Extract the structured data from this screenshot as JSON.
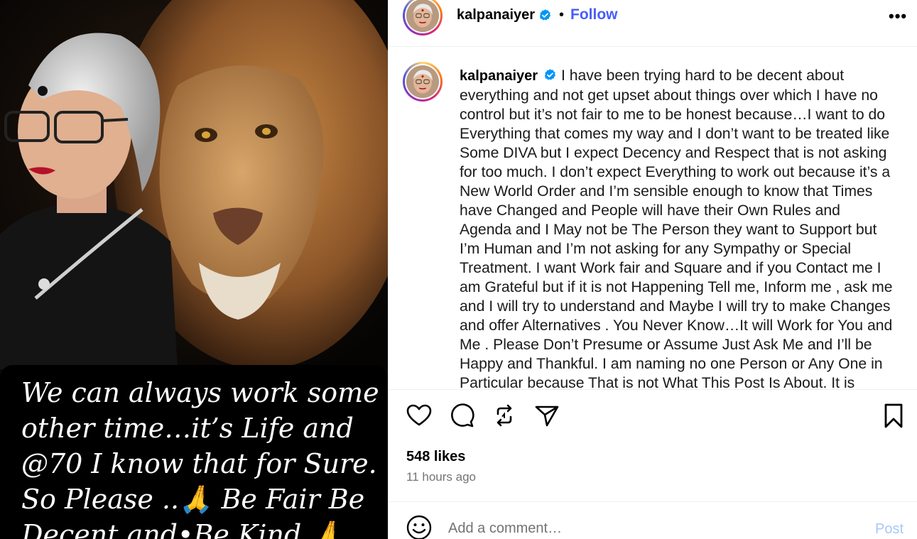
{
  "media": {
    "overlay_lines": [
      "We can always work some",
      "other time…it’s Life and",
      "@70 I know that for Sure.",
      "So Please ..🙏 Be Fair Be",
      "Decent and•Be Kind 🙏"
    ]
  },
  "header": {
    "username": "kalpanaiyer",
    "separator": "•",
    "follow_label": "Follow",
    "more_label": "•••"
  },
  "caption": {
    "username": "kalpanaiyer",
    "text": "I have been trying hard to be decent about everything and not get upset about things over which I have no control but it’s not fair to me to be honest because…I want to do Everything that comes my way and I don’t want to be treated like Some DIVA but I expect Decency and Respect that is not asking for too much. I don’t expect Everything to work out because it’s a New World Order and I’m sensible enough to know that Times have Changed and People will have their Own Rules and Agenda and I May not be The Person they want to Support but I’m Human and I’m not asking for any Sympathy or Special Treatment. I want Work fair and Square and if you Contact me I am Grateful but if it is not Happening Tell me, Inform me , ask me and I will try to understand and Maybe I will try to make Changes and offer Alternatives . You Never Know…It will Work for You and Me . Please Don’t Presume or Assume Just Ask Me and I’ll be Happy and Thankful. I am naming no one Person or Any One in Particular because That is not What This Post Is About. It is about"
  },
  "stats": {
    "likes": "548 likes",
    "time_ago": "11 hours ago"
  },
  "comment": {
    "placeholder": "Add a comment…",
    "post_label": "Post"
  },
  "colors": {
    "follow": "#4a5cf7",
    "verified": "#0095f6",
    "post_disabled": "#a6c8f7"
  },
  "icons": [
    "heart-icon",
    "comment-icon",
    "repost-icon",
    "share-icon",
    "bookmark-icon",
    "emoji-icon",
    "verified-badge-icon"
  ]
}
